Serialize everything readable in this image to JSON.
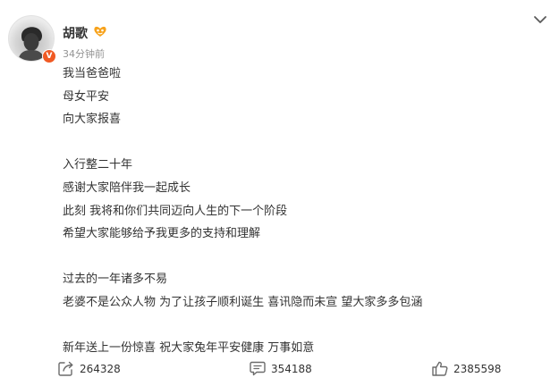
{
  "post": {
    "author": "胡歌",
    "timestamp": "34分钟前",
    "lines": [
      "我当爸爸啦",
      "母女平安",
      "向大家报喜",
      "",
      "入行整二十年",
      "感谢大家陪伴我一起成长",
      "此刻 我将和你们共同迈向人生的下一个阶段",
      "希望大家能够给予我更多的支持和理解",
      "",
      "过去的一年诸多不易",
      "老婆不是公众人物 为了让孩子顺利诞生 喜讯隐而未宣 望大家多多包涵",
      "",
      "新年送上一份惊喜 祝大家兔年平安健康 万事如意"
    ]
  },
  "actions": {
    "repost_count": "264328",
    "comment_count": "354188",
    "like_count": "2385598"
  },
  "icons": {
    "more": "chevron-down-icon",
    "repost": "repost-icon",
    "comment": "comment-icon",
    "like": "thumbs-up-icon",
    "vip": "vip-heart-icon",
    "verified": "verified-badge-icon"
  },
  "colors": {
    "verified_badge": "#f05a24",
    "vip_badge": "#f7a21b",
    "text": "#333333",
    "muted": "#939393"
  }
}
